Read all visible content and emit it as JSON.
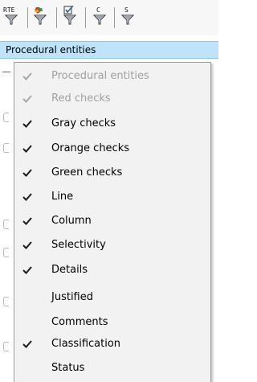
{
  "toolbar": {
    "buttons": [
      {
        "label": "RTE",
        "icon": "filter-funnel-icon"
      },
      {
        "label": "",
        "icon": "color-filter-funnel-icon"
      },
      {
        "label": "",
        "icon": "check-filter-funnel-icon"
      },
      {
        "label": "C",
        "icon": "filter-funnel-icon"
      },
      {
        "label": "S",
        "icon": "filter-funnel-icon"
      }
    ]
  },
  "header": {
    "title": "Procedural entities"
  },
  "menu": {
    "items": [
      {
        "label": "Procedural entities",
        "checked": true,
        "enabled": false
      },
      {
        "label": "Red checks",
        "checked": true,
        "enabled": false
      },
      {
        "label": "Gray checks",
        "checked": true,
        "enabled": true
      },
      {
        "label": "Orange checks",
        "checked": true,
        "enabled": true
      },
      {
        "label": "Green checks",
        "checked": true,
        "enabled": true
      },
      {
        "label": "Line",
        "checked": true,
        "enabled": true
      },
      {
        "label": "Column",
        "checked": true,
        "enabled": true
      },
      {
        "label": "Selectivity",
        "checked": true,
        "enabled": true
      },
      {
        "label": "Details",
        "checked": true,
        "enabled": true
      },
      {
        "label": "Justified",
        "checked": false,
        "enabled": true
      },
      {
        "label": "Comments",
        "checked": false,
        "enabled": true
      },
      {
        "label": "Classification",
        "checked": true,
        "enabled": true
      },
      {
        "label": "Status",
        "checked": false,
        "enabled": true
      }
    ]
  },
  "colors": {
    "header_bg": "#bfe3f8",
    "check_enabled": "#1a1a1a",
    "check_disabled": "#a8a8a8",
    "text_disabled": "#a0a0a0"
  }
}
